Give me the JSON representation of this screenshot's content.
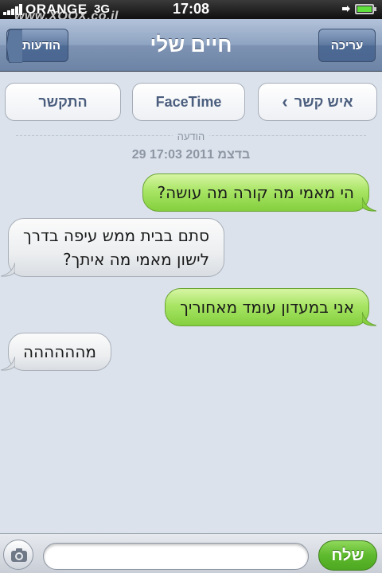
{
  "status_bar": {
    "carrier": "ORANGE",
    "network": "3G",
    "time": "17:08",
    "watermark": "www.XOOX.co.il"
  },
  "nav": {
    "back_label": "הודעות",
    "title": "חיים שלי",
    "edit_label": "עריכה"
  },
  "actions": {
    "call_label": "התקשר",
    "facetime_label": "FaceTime",
    "contact_label": "איש קשר"
  },
  "timestamp": {
    "label": "הודעה",
    "date": "29 בדצמ 2011 17:03"
  },
  "messages": [
    {
      "type": "sent",
      "text": "הי מאמי מה קורה מה עושה?"
    },
    {
      "type": "received",
      "line1": "סתם בבית ממש עיפה בדרך",
      "line2": "לישון מאמי מה איתך?"
    },
    {
      "type": "sent",
      "text": "אני במעדון עומד מאחוריך"
    },
    {
      "type": "received",
      "text": "מהההההה"
    }
  ],
  "composer": {
    "placeholder": "",
    "send_label": "שלח"
  },
  "icons": {
    "camera": "camera-icon",
    "back": "chevron-left-icon",
    "contact": "chevron-left-icon",
    "battery": "battery-icon",
    "signal": "signal-icon",
    "charging": "plug-icon"
  },
  "colors": {
    "sent_bubble": "#9ee05a",
    "received_bubble": "#eceef0",
    "send_button": "#5db92d",
    "nav_bar": "#8ea3c1"
  }
}
